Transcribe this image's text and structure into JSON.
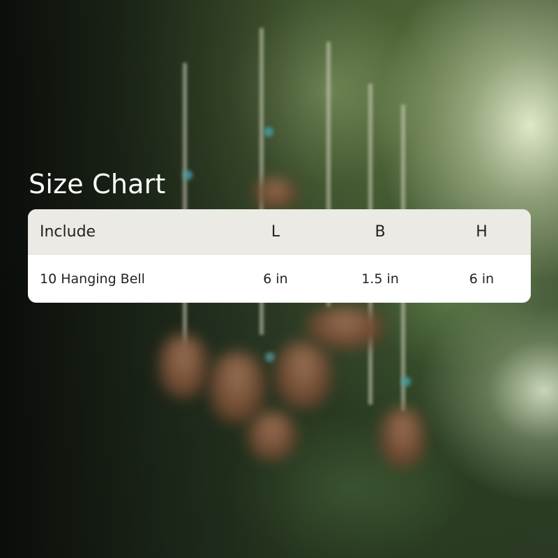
{
  "title": "Size Chart",
  "table": {
    "headers": [
      "Include",
      "L",
      "B",
      "H"
    ],
    "rows": [
      [
        "10 Hanging Bell",
        "6 in",
        "1.5 in",
        "6 in"
      ]
    ]
  }
}
